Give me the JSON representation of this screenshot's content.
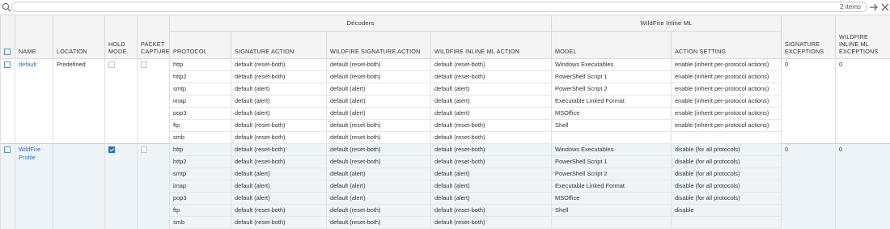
{
  "toolbar": {
    "search_value": "",
    "items_count": "2 items"
  },
  "headers": {
    "groups": {
      "decoders": "Decoders",
      "wildfire_inline_ml": "WildFire Inline ML"
    },
    "name": "NAME",
    "location": "LOCATION",
    "hold_mode": "HOLD MODE",
    "packet_capture": "PACKET CAPTURE",
    "protocol": "PROTOCOL",
    "signature_action": "SIGNATURE ACTION",
    "wildfire_signature_action": "WILDFIRE SIGNATURE ACTION",
    "wildfire_inline_ml_action": "WILDFIRE INLINE ML ACTION",
    "model": "MODEL",
    "action_setting": "ACTION SETTING",
    "signature_exceptions": "SIGNATURE EXCEPTIONS",
    "wildfire_inline_ml_exceptions": "WILDFIRE INLINE ML EXCEPTIONS"
  },
  "profiles": [
    {
      "name": "default",
      "location": "Predefined",
      "hold_mode": false,
      "packet_capture": false,
      "signature_exceptions": "0",
      "wildfire_inline_ml_exceptions": "0",
      "decoders": [
        {
          "protocol": "http",
          "signature_action": "default (reset-both)",
          "wildfire_signature_action": "default (reset-both)",
          "wildfire_inline_ml_action": "default (reset-both)"
        },
        {
          "protocol": "http2",
          "signature_action": "default (reset-both)",
          "wildfire_signature_action": "default (reset-both)",
          "wildfire_inline_ml_action": "default (reset-both)"
        },
        {
          "protocol": "smtp",
          "signature_action": "default (alert)",
          "wildfire_signature_action": "default (alert)",
          "wildfire_inline_ml_action": "default (alert)"
        },
        {
          "protocol": "imap",
          "signature_action": "default (alert)",
          "wildfire_signature_action": "default (alert)",
          "wildfire_inline_ml_action": "default (alert)"
        },
        {
          "protocol": "pop3",
          "signature_action": "default (alert)",
          "wildfire_signature_action": "default (alert)",
          "wildfire_inline_ml_action": "default (alert)"
        },
        {
          "protocol": "ftp",
          "signature_action": "default (reset-both)",
          "wildfire_signature_action": "default (reset-both)",
          "wildfire_inline_ml_action": "default (reset-both)"
        },
        {
          "protocol": "smb",
          "signature_action": "default (reset-both)",
          "wildfire_signature_action": "default (reset-both)",
          "wildfire_inline_ml_action": "default (reset-both)"
        }
      ],
      "ml_models": [
        {
          "model": "Windows Executables",
          "action_setting": "enable (inherit per-protocol actions)"
        },
        {
          "model": "PowerShell Script 1",
          "action_setting": "enable (inherit per-protocol actions)"
        },
        {
          "model": "PowerShell Script 2",
          "action_setting": "enable (inherit per-protocol actions)"
        },
        {
          "model": "Executable Linked Format",
          "action_setting": "enable (inherit per-protocol actions)"
        },
        {
          "model": "MSOffice",
          "action_setting": "enable (inherit per-protocol actions)"
        },
        {
          "model": "Shell",
          "action_setting": "enable (inherit per-protocol actions)"
        },
        {
          "model": "",
          "action_setting": ""
        }
      ]
    },
    {
      "name": "WildFire Profile",
      "location": "",
      "hold_mode": true,
      "packet_capture": false,
      "signature_exceptions": "0",
      "wildfire_inline_ml_exceptions": "0",
      "decoders": [
        {
          "protocol": "http",
          "signature_action": "default (reset-both)",
          "wildfire_signature_action": "default (reset-both)",
          "wildfire_inline_ml_action": "default (reset-both)"
        },
        {
          "protocol": "http2",
          "signature_action": "default (reset-both)",
          "wildfire_signature_action": "default (reset-both)",
          "wildfire_inline_ml_action": "default (reset-both)"
        },
        {
          "protocol": "smtp",
          "signature_action": "default (alert)",
          "wildfire_signature_action": "default (alert)",
          "wildfire_inline_ml_action": "default (alert)"
        },
        {
          "protocol": "imap",
          "signature_action": "default (alert)",
          "wildfire_signature_action": "default (alert)",
          "wildfire_inline_ml_action": "default (alert)"
        },
        {
          "protocol": "pop3",
          "signature_action": "default (alert)",
          "wildfire_signature_action": "default (alert)",
          "wildfire_inline_ml_action": "default (alert)"
        },
        {
          "protocol": "ftp",
          "signature_action": "default (reset-both)",
          "wildfire_signature_action": "default (reset-both)",
          "wildfire_inline_ml_action": "default (reset-both)"
        },
        {
          "protocol": "smb",
          "signature_action": "default (reset-both)",
          "wildfire_signature_action": "default (reset-both)",
          "wildfire_inline_ml_action": "default (reset-both)"
        }
      ],
      "ml_models": [
        {
          "model": "Windows Executables",
          "action_setting": "disable (for all protocols)"
        },
        {
          "model": "PowerShell Script 1",
          "action_setting": "disable (for all protocols)"
        },
        {
          "model": "PowerShell Script 2",
          "action_setting": "disable (for all protocols)"
        },
        {
          "model": "Executable Linked Format",
          "action_setting": "disable (for all protocols)"
        },
        {
          "model": "MSOffice",
          "action_setting": "disable (for all protocols)"
        },
        {
          "model": "Shell",
          "action_setting": "disable"
        },
        {
          "model": "",
          "action_setting": ""
        }
      ]
    }
  ],
  "colors": {
    "link": "#2a6ebb",
    "selected_row": "#eef4f8",
    "header_bg": "#f4f4f4",
    "checkbox_checked": "#2a6ebb"
  },
  "icons": {
    "search": "magnifier-icon",
    "apply": "arrow-right-icon",
    "clear": "close-icon"
  }
}
